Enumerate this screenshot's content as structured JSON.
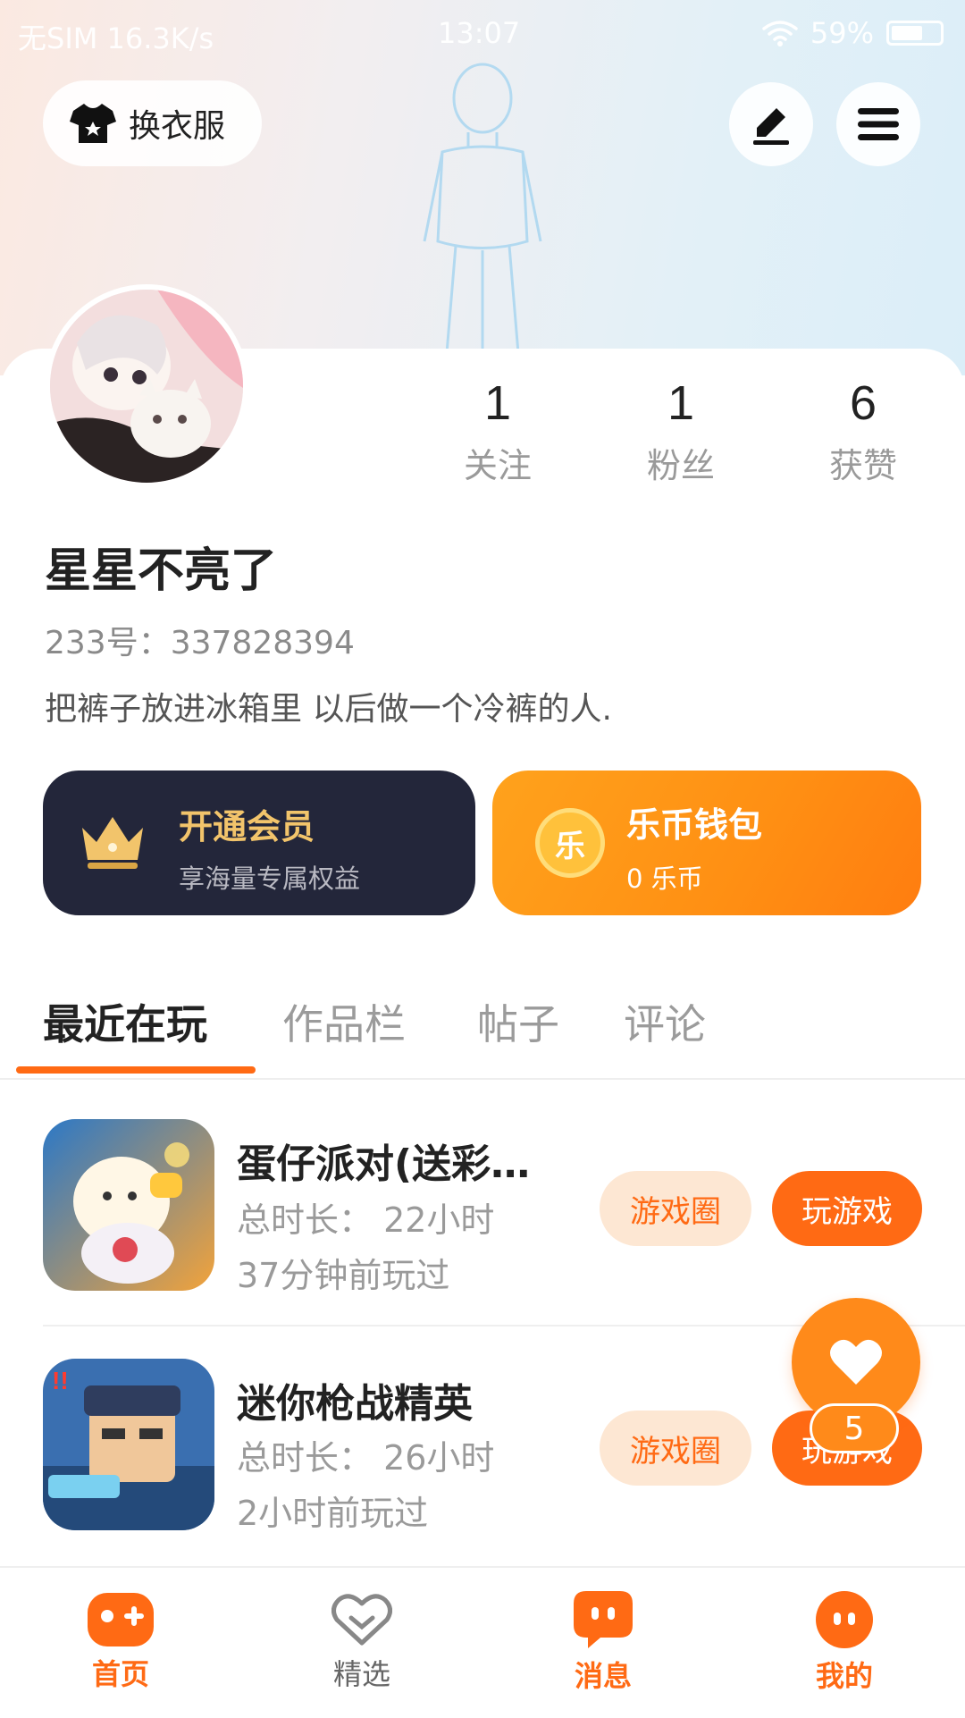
{
  "status_bar": {
    "carrier": "无SIM 16.3K/s",
    "time": "13:07",
    "battery": "59%"
  },
  "header": {
    "outfit_button": "换衣服"
  },
  "profile": {
    "stats": [
      {
        "value": "1",
        "label": "关注"
      },
      {
        "value": "1",
        "label": "粉丝"
      },
      {
        "value": "6",
        "label": "获赞"
      }
    ],
    "nickname": "星星不亮了",
    "uid": "233号：337828394",
    "bio": "把裤子放进冰箱里 以后做一个冷裤的人."
  },
  "vip": {
    "title": "开通会员",
    "subtitle": "享海量专属权益"
  },
  "wallet": {
    "title": "乐币钱包",
    "subtitle": "0 乐币",
    "coin_glyph": "乐"
  },
  "tabs": [
    {
      "label": "最近在玩",
      "active": true
    },
    {
      "label": "作品栏"
    },
    {
      "label": "帖子"
    },
    {
      "label": "评论"
    }
  ],
  "games": [
    {
      "title": "蛋仔派对(送彩…",
      "duration": "总时长：  22小时",
      "last_played": "37分钟前玩过",
      "circle_label": "游戏圈",
      "play_label": "玩游戏"
    },
    {
      "title": "迷你枪战精英",
      "duration": "总时长：  26小时",
      "last_played": "2小时前玩过",
      "circle_label": "游戏圈",
      "play_label": "玩游戏"
    }
  ],
  "floating": {
    "like_count": "5"
  },
  "bottom_nav": [
    {
      "label": "首页",
      "active": true
    },
    {
      "label": "精选"
    },
    {
      "label": "消息"
    },
    {
      "label": "我的"
    }
  ],
  "colors": {
    "accent": "#ff6a14",
    "vip_bg": "#23263a",
    "wallet": "#ff8f13",
    "vip_gold": "#f2c46b"
  }
}
